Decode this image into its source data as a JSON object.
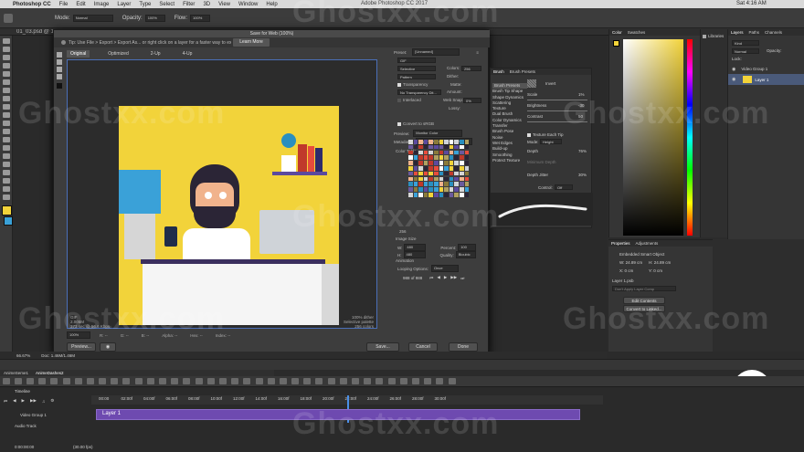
{
  "menubar": {
    "apple": "",
    "items": [
      "Photoshop CC",
      "File",
      "Edit",
      "Image",
      "Layer",
      "Type",
      "Select",
      "Filter",
      "3D",
      "View",
      "Window",
      "Help"
    ],
    "center_title": "Adobe Photoshop CC 2017",
    "clock": "Sat 4:16 AM"
  },
  "options_bar": {
    "mode_label": "Mode:",
    "mode_value": "Normal",
    "opacity_label": "Opacity:",
    "opacity_value": "100%",
    "flow_label": "Flow:",
    "flow_value": "100%"
  },
  "doc_tab": "01_03.psd @ 100% (Layer 1, RGB/8) *",
  "dialog": {
    "title": "Save for Web (100%)",
    "tip": "Tip: Use File > Export > Export As... or right click on a layer for a faster way to export assets.",
    "learn_more": "Learn More",
    "tabs": [
      "Original",
      "Optimized",
      "2-Up",
      "4-Up"
    ],
    "active_tab": "Original",
    "preview_info_left": [
      "GIF",
      "2.005M",
      "373 sec @ 56.6 Kbps"
    ],
    "preview_info_right": [
      "100% dither",
      "Selective palette",
      "256 colors"
    ],
    "zoom": "100%",
    "bottom_fields": [
      "R: --",
      "G: --",
      "B: --",
      "Alpha: --",
      "Hex: --",
      "Index: --"
    ],
    "buttons": {
      "preview": "Preview...",
      "save": "Save...",
      "cancel": "Cancel",
      "done": "Done"
    },
    "settings": {
      "preset_label": "Preset:",
      "preset_value": "[Unnamed]",
      "format": "GIF",
      "reduction": "Selective",
      "colors_label": "Colors:",
      "colors_value": "256",
      "dither_algo": "Pattern",
      "dither_label": "Dither:",
      "transparency": "Transparency",
      "matte_label": "Matte:",
      "no_transparency": "No Transparency Dit...",
      "amount_label": "Amount:",
      "interlaced": "Interlaced",
      "websnap_label": "Web Snap:",
      "websnap_value": "0%",
      "lossy_label": "Lossy:",
      "convert_srgb": "Convert to sRGB",
      "preview_label": "Preview:",
      "preview_value": "Monitor Color",
      "metadata_label": "Metadata:",
      "metadata_value": "Copyright and Contact Info",
      "color_table_label": "Color Table",
      "color_count": "256",
      "image_size_label": "Image Size",
      "w_label": "W:",
      "w_value": "480",
      "h_label": "H:",
      "h_value": "480",
      "percent_label": "Percent:",
      "percent_value": "100",
      "quality_label": "Quality:",
      "quality_value": "Bicubic",
      "animation_label": "Animation",
      "looping_label": "Looping Options:",
      "looping_value": "Once",
      "frame_counter": "988 of 988"
    }
  },
  "brush_panel": {
    "tabs": [
      "Brush",
      "Brush Presets"
    ],
    "list": [
      "Brush Presets",
      "Brush Tip Shape",
      "Shape Dynamics",
      "Scattering",
      "Texture",
      "Dual Brush",
      "Color Dynamics",
      "Transfer",
      "Brush Pose",
      "Noise",
      "Wet Edges",
      "Build-up",
      "Smoothing",
      "Protect Texture"
    ],
    "invert": "Invert",
    "scale_label": "Scale",
    "scale_value": "1%",
    "brightness_label": "Brightness",
    "brightness_value": "-30",
    "contrast_label": "Contrast",
    "contrast_value": "50",
    "texture_each_tip": "Texture Each Tip",
    "mode_label": "Mode:",
    "mode_value": "Height",
    "depth_label": "Depth",
    "depth_value": "76%",
    "min_depth_label": "Minimum Depth",
    "depth_jitter_label": "Depth Jitter",
    "depth_jitter_value": "30%",
    "control_label": "Control:",
    "control_value": "Off"
  },
  "color_panel": {
    "tabs": [
      "Color",
      "Swatches"
    ]
  },
  "libraries": {
    "label": "Libraries"
  },
  "layers_panel": {
    "tabs": [
      "Layers",
      "Paths",
      "Channels"
    ],
    "kind_label": "Kind",
    "blend": "Normal",
    "opacity": "Opacity:",
    "lock": "Lock:",
    "items": [
      "Video Group 1",
      "Layer 1"
    ]
  },
  "properties": {
    "tabs": [
      "Properties",
      "Adjustments"
    ],
    "object": "Embedded Smart Object",
    "w": "W: 24.89 cm",
    "h": "H: 24.89 cm",
    "x": "X: 0 cm",
    "y": "Y: 0 cm",
    "layer_comp": "Layer 1.psb",
    "comp_placeholder": "Don't Apply Layer Comp",
    "edit_contents": "Edit Contents",
    "convert_linked": "Convert to Linked..."
  },
  "status": {
    "zoom": "66.67%",
    "doc": "Doc: 1.46M/1.46M"
  },
  "doc_tabs": [
    "AnimeSeme1",
    "AnimeDashes2"
  ],
  "timeline": {
    "title": "Timeline",
    "times": [
      "00:00",
      "02:00f",
      "04:00f",
      "06:00f",
      "08:00f",
      "10:00f",
      "12:00f",
      "14:00f",
      "16:00f",
      "18:00f",
      "20:00f",
      "22:00f",
      "24:00f",
      "26:00f",
      "28:00f",
      "30:00f"
    ],
    "tracks": [
      "Video Group 1",
      "Audio Track"
    ],
    "clip_label": "Layer 1",
    "timecode": "0:00:00:00",
    "fps": "(30.00 fps)"
  },
  "watermark": "Ghostxx.com",
  "colors": {
    "accent_blue": "#4b6fb8",
    "art_yellow": "#f2d33a",
    "clip_purple": "#6e4ab0",
    "logo_red": "#e32b2b"
  }
}
